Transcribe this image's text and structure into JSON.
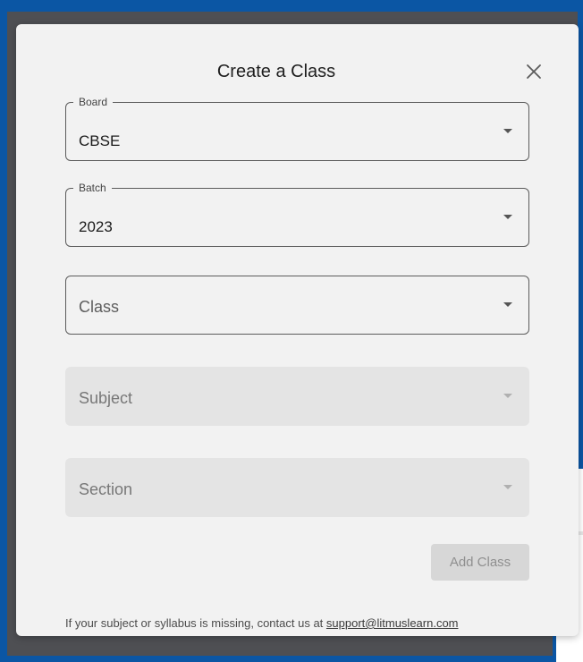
{
  "dialog": {
    "title": "Create a Class",
    "close_icon": "close-icon"
  },
  "fields": {
    "board": {
      "label": "Board",
      "value": "CBSE"
    },
    "batch": {
      "label": "Batch",
      "value": "2023"
    },
    "class": {
      "placeholder": "Class"
    },
    "subject": {
      "placeholder": "Subject"
    },
    "section": {
      "placeholder": "Section"
    }
  },
  "actions": {
    "add_class_label": "Add Class"
  },
  "footer": {
    "text": "If your subject or syllabus is missing, contact us at",
    "email": "support@litmuslearn.com"
  },
  "side_widget": {
    "logo_text": "?"
  },
  "colors": {
    "frame": "#0b56a4",
    "modal_bg": "#f2f2f2",
    "logo": "#d3232a"
  }
}
